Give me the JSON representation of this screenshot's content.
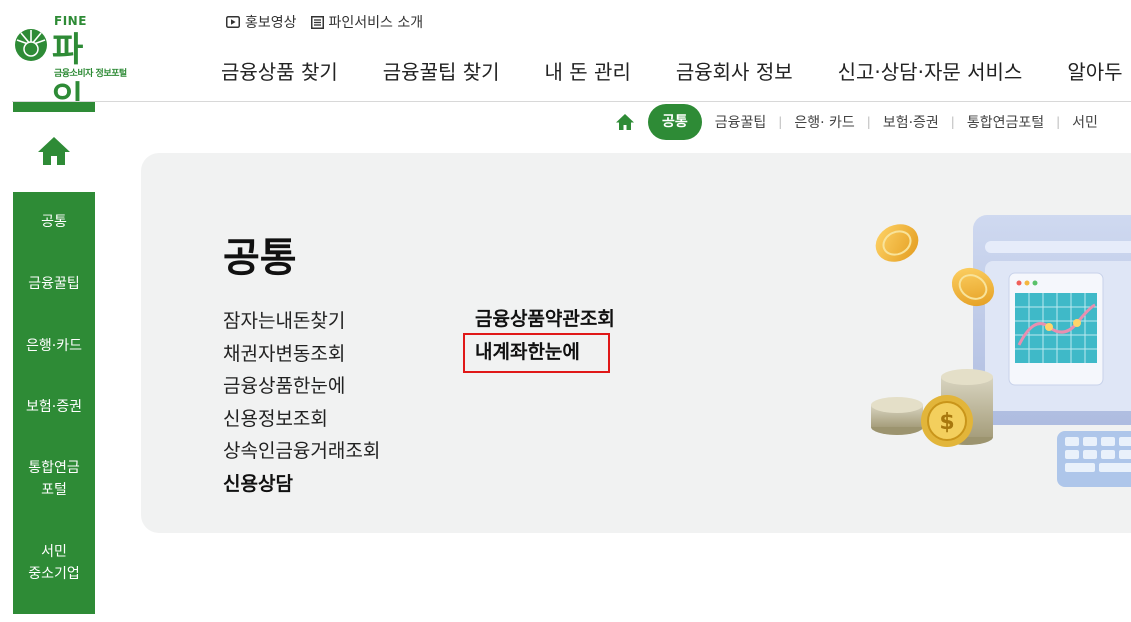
{
  "logo": {
    "top_text": "FINE",
    "name": "파 인",
    "subtitle": "금융소비자 정보포털"
  },
  "util_links": [
    {
      "label": "홍보영상",
      "icon": "play-icon"
    },
    {
      "label": "파인서비스 소개",
      "icon": "list-icon"
    }
  ],
  "gnb": [
    {
      "label": "금융상품 찾기"
    },
    {
      "label": "금융꿀팁 찾기"
    },
    {
      "label": "내 돈 관리"
    },
    {
      "label": "금융회사 정보"
    },
    {
      "label": "신고·상담·자문 서비스"
    },
    {
      "label": "알아두"
    }
  ],
  "sidenav": {
    "home_icon": "home-icon",
    "items": [
      {
        "label": "공통"
      },
      {
        "label": "금융꿀팁"
      },
      {
        "label": "은행·카드"
      },
      {
        "label": "보험·증권"
      },
      {
        "label": "통합연금\n포털"
      },
      {
        "label": "서민\n중소기업"
      }
    ]
  },
  "breadcrumb": {
    "home_icon": "home-icon",
    "active": "공통",
    "items": [
      {
        "label": "금융꿀팁"
      },
      {
        "label": "은행· 카드"
      },
      {
        "label": "보험·증권"
      },
      {
        "label": "통합연금포털"
      },
      {
        "label": "서민"
      }
    ]
  },
  "panel": {
    "title": "공통",
    "col1": [
      {
        "label": "잠자는내돈찾기"
      },
      {
        "label": "채권자변동조회"
      },
      {
        "label": "금융상품한눈에"
      },
      {
        "label": "신용정보조회"
      },
      {
        "label": "상속인금융거래조회"
      },
      {
        "label": "신용상담"
      }
    ],
    "col2": [
      {
        "label": "금융상품약관조회"
      },
      {
        "label": "내계좌한눈에"
      }
    ],
    "highlighted": "내계좌한눈에"
  },
  "colors": {
    "brand_green": "#2e8b36",
    "panel_bg": "#f1f2f2",
    "highlight_red": "#e01818"
  }
}
